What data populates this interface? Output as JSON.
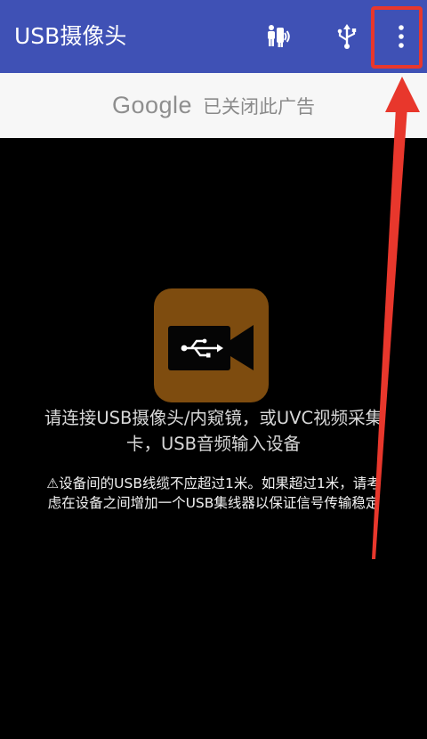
{
  "app_bar": {
    "title": "USB摄像头",
    "background_color": "#3f51b5",
    "actions": [
      {
        "icon": "camera-with-people-icon"
      },
      {
        "icon": "usb-icon"
      },
      {
        "icon": "more-vert-icon"
      }
    ]
  },
  "ad_banner": {
    "logo_text": "Google",
    "status_text": "已关闭此广告"
  },
  "main": {
    "camera_icon": "usb-camera-icon",
    "camera_tile_color": "#7e4c0f",
    "message_line1": "请连接USB摄像头/内窥镜，或UVC视频采集",
    "message_line2": "卡，USB音频输入设备",
    "warning_line1": "⚠设备间的USB线缆不应超过1米。如果超过1米，请考",
    "warning_line2": "虑在设备之间增加一个USB集线器以保证信号传输稳定"
  },
  "annotation": {
    "highlight_color": "#e8372c",
    "target": "more-vert-icon"
  }
}
